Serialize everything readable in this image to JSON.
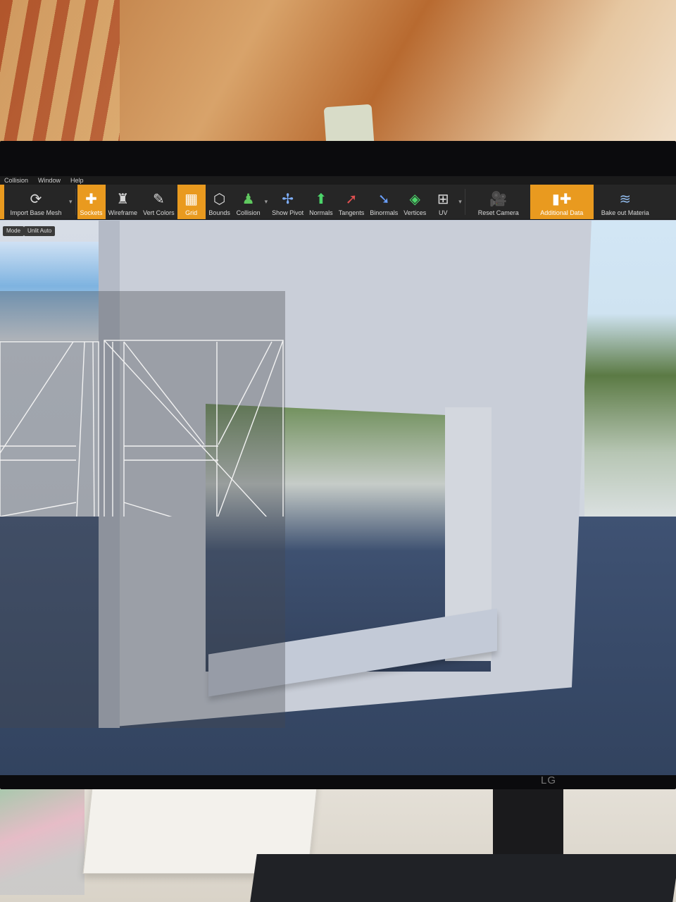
{
  "menu": {
    "items": [
      "Collision",
      "Window",
      "Help"
    ]
  },
  "toolbar": {
    "import_base_mesh": "Import Base Mesh",
    "buttons": [
      {
        "label": "Sockets",
        "icon": "sockets-icon",
        "active": true
      },
      {
        "label": "Wireframe",
        "icon": "wireframe-icon",
        "active": false
      },
      {
        "label": "Vert Colors",
        "icon": "vert-colors-icon",
        "active": false
      },
      {
        "label": "Grid",
        "icon": "grid-icon",
        "active": true
      },
      {
        "label": "Bounds",
        "icon": "bounds-icon",
        "active": false
      },
      {
        "label": "Collision",
        "icon": "collision-icon",
        "active": false
      },
      {
        "label": "Show Pivot",
        "icon": "pivot-icon",
        "active": false
      },
      {
        "label": "Normals",
        "icon": "normals-icon",
        "active": false
      },
      {
        "label": "Tangents",
        "icon": "tangents-icon",
        "active": false
      },
      {
        "label": "Binormals",
        "icon": "binormals-icon",
        "active": false
      },
      {
        "label": "Vertices",
        "icon": "vertices-icon",
        "active": false
      },
      {
        "label": "UV",
        "icon": "uv-icon",
        "active": false
      }
    ],
    "reset_camera": "Reset Camera",
    "additional_data": "Additional Data",
    "bake_out_materials": "Bake out Materia"
  },
  "viewport": {
    "chip_mode": "Mode",
    "chip_lit": "Unlit Auto"
  },
  "monitor": {
    "brand": "LG"
  },
  "colors": {
    "active": "#e99a1f",
    "toolbar_bg": "#262626"
  }
}
